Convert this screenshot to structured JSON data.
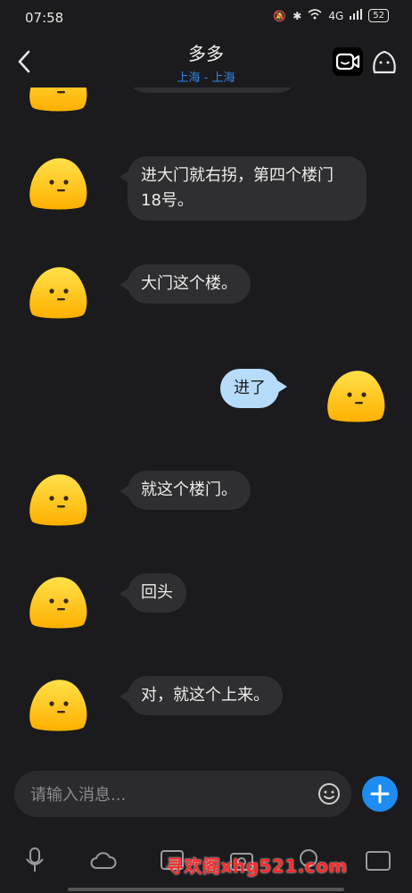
{
  "status_bar": {
    "time": "07:58",
    "network": "4G",
    "battery": "52"
  },
  "header": {
    "title": "多多",
    "subtitle": "上海 - 上海",
    "back_icon": "chevron-left-icon",
    "video_icon": "video-call-icon",
    "profile_icon": "avatar-profile-icon"
  },
  "messages": [
    {
      "side": "left",
      "text": "进大门就右拐，第四个楼门18号。"
    },
    {
      "side": "left",
      "text": "大门这个楼。"
    },
    {
      "side": "right",
      "text": "进了"
    },
    {
      "side": "left",
      "text": "就这个楼门。"
    },
    {
      "side": "left",
      "text": "回头"
    },
    {
      "side": "left",
      "text": "对，就这个上来。"
    }
  ],
  "composer": {
    "placeholder": "请输入消息...",
    "emoji_icon": "emoji-icon",
    "plus_icon": "plus-icon"
  },
  "toolbar": {
    "items": [
      "microphone-icon",
      "cloud-icon",
      "image-icon",
      "camera-icon",
      "search-icon",
      "gif-icon"
    ]
  },
  "watermark": "寻欢阁xhg521.com",
  "colors": {
    "background": "#1b1b1d",
    "bubble_left": "#2f2f31",
    "bubble_right": "#b7dcfa",
    "accent": "#1e8cf0",
    "avatar_yellow": "#ffc91a"
  }
}
